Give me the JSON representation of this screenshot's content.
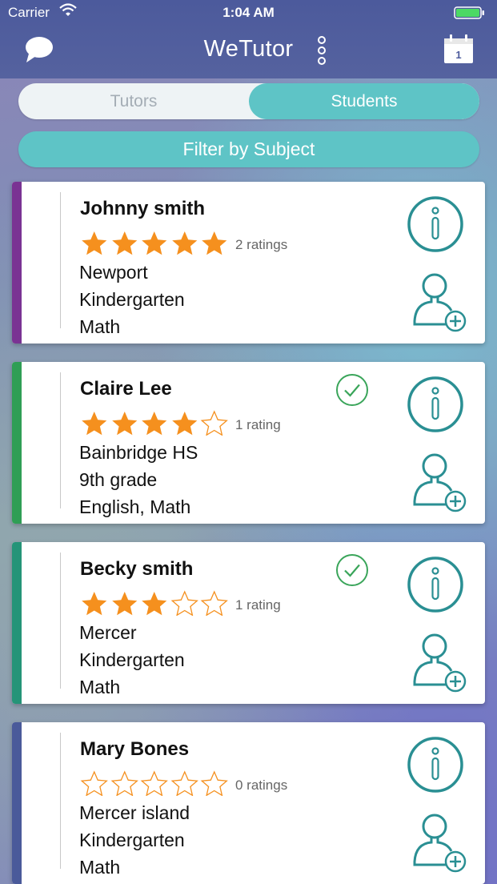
{
  "status_bar": {
    "carrier": "Carrier",
    "time": "1:04 AM",
    "wifi_icon": "wifi-icon",
    "battery_icon": "battery-charging-icon",
    "battery_color": "#4cd964"
  },
  "nav": {
    "title": "WeTutor",
    "left_icon": "chat-bubble-icon",
    "right_icon": "calendar-icon",
    "calendar_day": "1",
    "menu_icon": "vertical-dots-icon",
    "background": "#4f5c9e"
  },
  "segments": {
    "tutors_label": "Tutors",
    "students_label": "Students",
    "selected": "Students"
  },
  "filter": {
    "label": "Filter by Subject"
  },
  "colors": {
    "accent": "#5ec4c6",
    "teal_icon": "#2a8f93",
    "star": "#f5901e",
    "check": "#3aa55a"
  },
  "students": [
    {
      "name": "Johnny smith",
      "rating": 5,
      "rating_label": "2 ratings",
      "location": "Newport",
      "grade": "Kindergarten",
      "subjects": "Math",
      "verified": false,
      "stripe_color": "#7a3393"
    },
    {
      "name": "Claire Lee",
      "rating": 4,
      "rating_label": "1 rating",
      "location": "Bainbridge HS",
      "grade": "9th grade",
      "subjects": "English, Math",
      "verified": true,
      "stripe_color": "#2f9e55"
    },
    {
      "name": "Becky smith",
      "rating": 3,
      "rating_label": "1 rating",
      "location": "Mercer",
      "grade": "Kindergarten",
      "subjects": "Math",
      "verified": true,
      "stripe_color": "#259478"
    },
    {
      "name": "Mary Bones",
      "rating": 0,
      "rating_label": "0 ratings",
      "location": "Mercer island",
      "grade": "Kindergarten",
      "subjects": "Math",
      "verified": false,
      "stripe_color": "#4a5a9a"
    }
  ]
}
